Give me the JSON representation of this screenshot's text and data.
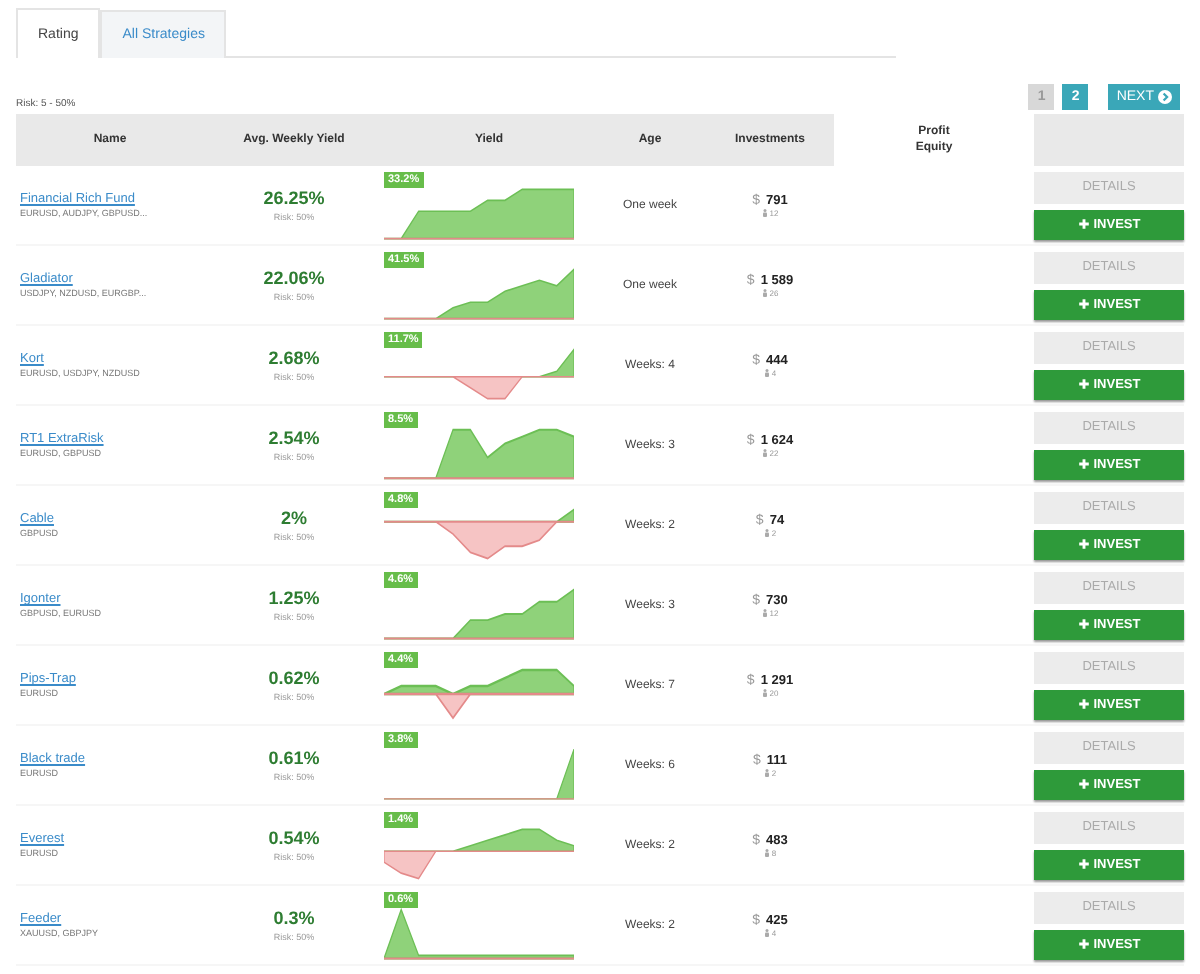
{
  "tabs": [
    {
      "label": "Rating",
      "selected": true
    },
    {
      "label": "All Strategies",
      "selected": false
    }
  ],
  "filter_label": "Risk: 5 - 50%",
  "pagination": {
    "pages": [
      {
        "label": "1",
        "selected": true
      },
      {
        "label": "2",
        "selected": false
      }
    ],
    "next": "NEXT"
  },
  "table": {
    "columns": [
      "Name",
      "Avg. Weekly Yield",
      "Yield",
      "Age",
      "Investments",
      "Profit",
      "Equity"
    ],
    "rows": [
      {
        "name": "Financial Rich Fund",
        "pairs": "EURUSD, AUDJPY, GBPUSD...",
        "weekly_yield": "26.25%",
        "risk": "Risk: 50%",
        "yield_badge": "33.2%",
        "age": "One week",
        "currency": "$",
        "amount": "791",
        "investors": "12",
        "details": "DETAILS",
        "invest": "INVEST"
      },
      {
        "name": "Gladiator",
        "pairs": "USDJPY, NZDUSD, EURGBP...",
        "weekly_yield": "22.06%",
        "risk": "Risk: 50%",
        "yield_badge": "41.5%",
        "age": "One week",
        "currency": "$",
        "amount": "1 589",
        "investors": "26",
        "details": "DETAILS",
        "invest": "INVEST"
      },
      {
        "name": "Kort",
        "pairs": "EURUSD, USDJPY, NZDUSD",
        "weekly_yield": "2.68%",
        "risk": "Risk: 50%",
        "yield_badge": "11.7%",
        "age": "Weeks: 4",
        "currency": "$",
        "amount": "444",
        "investors": "4",
        "details": "DETAILS",
        "invest": "INVEST"
      },
      {
        "name": "RT1 ExtraRisk",
        "pairs": "EURUSD, GBPUSD",
        "weekly_yield": "2.54%",
        "risk": "Risk: 50%",
        "yield_badge": "8.5%",
        "age": "Weeks: 3",
        "currency": "$",
        "amount": "1 624",
        "investors": "22",
        "details": "DETAILS",
        "invest": "INVEST"
      },
      {
        "name": "Cable",
        "pairs": "GBPUSD",
        "weekly_yield": "2%",
        "risk": "Risk: 50%",
        "yield_badge": "4.8%",
        "age": "Weeks: 2",
        "currency": "$",
        "amount": "74",
        "investors": "2",
        "details": "DETAILS",
        "invest": "INVEST"
      },
      {
        "name": "Igonter",
        "pairs": "GBPUSD, EURUSD",
        "weekly_yield": "1.25%",
        "risk": "Risk: 50%",
        "yield_badge": "4.6%",
        "age": "Weeks: 3",
        "currency": "$",
        "amount": "730",
        "investors": "12",
        "details": "DETAILS",
        "invest": "INVEST"
      },
      {
        "name": "Pips-Trap",
        "pairs": "EURUSD",
        "weekly_yield": "0.62%",
        "risk": "Risk: 50%",
        "yield_badge": "4.4%",
        "age": "Weeks: 7",
        "currency": "$",
        "amount": "1 291",
        "investors": "20",
        "details": "DETAILS",
        "invest": "INVEST"
      },
      {
        "name": "Black trade",
        "pairs": "EURUSD",
        "weekly_yield": "0.61%",
        "risk": "Risk: 50%",
        "yield_badge": "3.8%",
        "age": "Weeks: 6",
        "currency": "$",
        "amount": "111",
        "investors": "2",
        "details": "DETAILS",
        "invest": "INVEST"
      },
      {
        "name": "Everest",
        "pairs": "EURUSD",
        "weekly_yield": "0.54%",
        "risk": "Risk: 50%",
        "yield_badge": "1.4%",
        "age": "Weeks: 2",
        "currency": "$",
        "amount": "483",
        "investors": "8",
        "details": "DETAILS",
        "invest": "INVEST"
      },
      {
        "name": "Feeder",
        "pairs": "XAUUSD, GBPJPY",
        "weekly_yield": "0.3%",
        "risk": "Risk: 50%",
        "yield_badge": "0.6%",
        "age": "Weeks: 2",
        "currency": "$",
        "amount": "425",
        "investors": "4",
        "details": "DETAILS",
        "invest": "INVEST"
      }
    ]
  }
}
